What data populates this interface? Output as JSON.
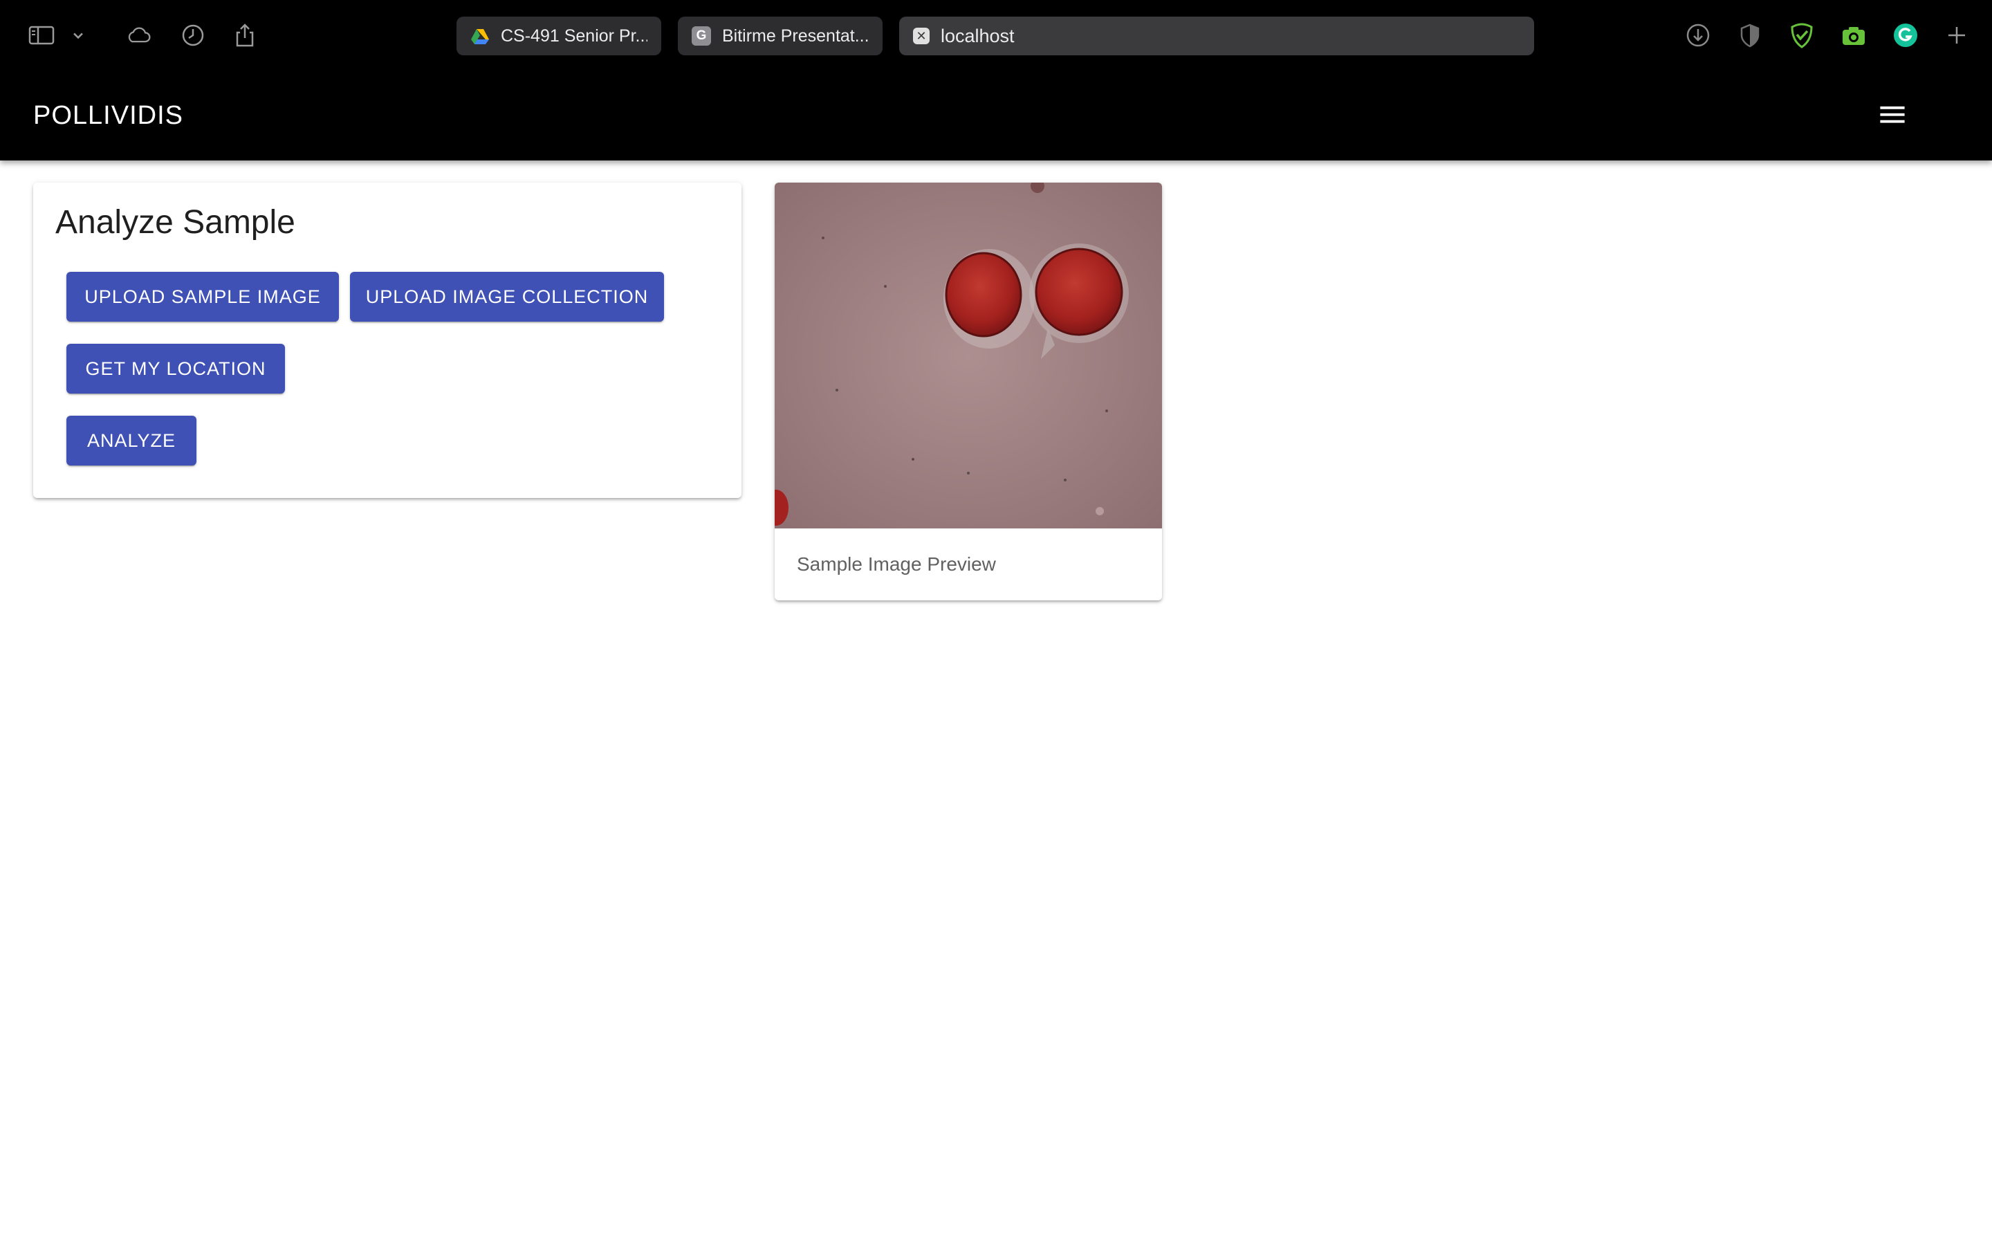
{
  "browser": {
    "tabs": [
      {
        "label": "CS-491 Senior Pr...",
        "favicon": "google-drive-icon"
      },
      {
        "label": "Bitirme Presentat...",
        "favicon": "G"
      },
      {
        "label": "localhost",
        "favicon": "close-icon"
      }
    ],
    "icons": [
      "sidebar-icon",
      "chevron-down-icon",
      "cloud-icon",
      "history-icon",
      "share-icon",
      "download-icon",
      "shield-icon",
      "adguard-icon",
      "camera-icon",
      "grammarly-icon",
      "plus-icon"
    ]
  },
  "app": {
    "title": "POLLIVIDIS",
    "menu_icon": "hamburger-menu-icon"
  },
  "analyze": {
    "heading": "Analyze Sample",
    "upload_sample_label": "Upload Sample Image",
    "upload_collection_label": "Upload Image Collection",
    "location_label": "Get My Location",
    "analyze_label": "Analyze"
  },
  "preview": {
    "caption": "Sample Image Preview"
  },
  "colors": {
    "primary": "#3f51b5",
    "appbar": "#000000",
    "browser_bar": "#000000"
  }
}
